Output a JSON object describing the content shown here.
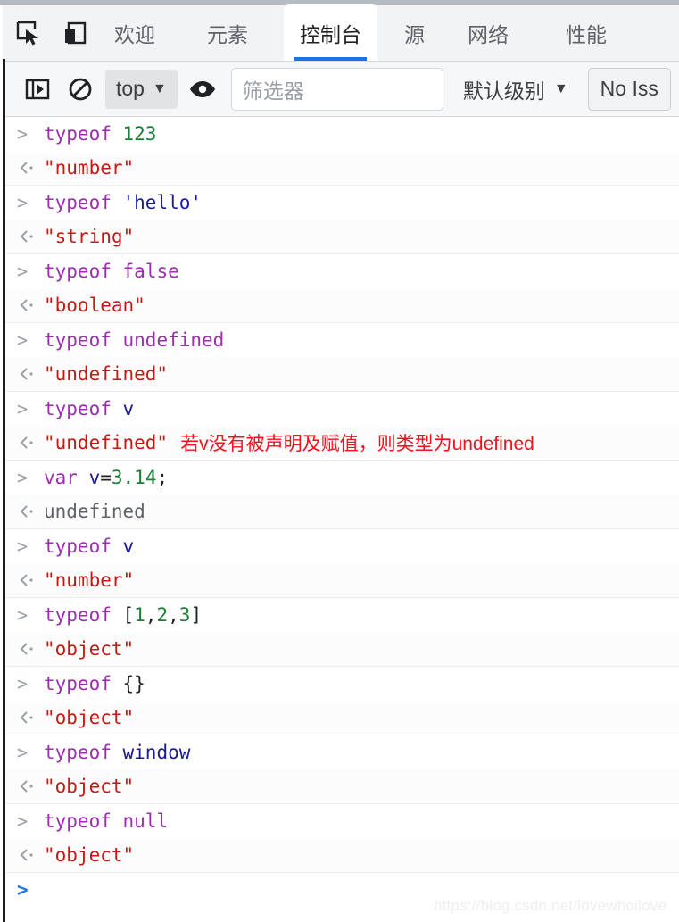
{
  "window": {
    "devtools_tabs": [
      {
        "label": "欢迎",
        "name": "tab-welcome",
        "active": false
      },
      {
        "label": "元素",
        "name": "tab-elements",
        "active": false
      },
      {
        "label": "控制台",
        "name": "tab-console",
        "active": true
      },
      {
        "label": "源",
        "name": "tab-sources",
        "active": false
      },
      {
        "label": "网络",
        "name": "tab-network",
        "active": false
      },
      {
        "label": "性能",
        "name": "tab-performance",
        "active": false
      }
    ],
    "icons": {
      "inspect": "inspect-element-icon",
      "device": "device-toolbar-icon"
    },
    "accent_color": "#1a73e8"
  },
  "toolbar": {
    "sidebar_toggle_icon": "console-sidebar-icon",
    "clear_console_icon": "clear-console-icon",
    "context_selector": {
      "value": "top",
      "caret": "▼"
    },
    "eye_icon": "live-expression-eye-icon",
    "filter": {
      "placeholder": "筛选器",
      "value": ""
    },
    "level_selector": {
      "label": "默认级别",
      "caret": "▼"
    },
    "issues_button": {
      "label": "No Iss"
    }
  },
  "console": {
    "prompt_glyph": ">",
    "result_glyph": "‹·",
    "input_prompt": ">",
    "entries": [
      {
        "command_parts": [
          {
            "text": "typeof ",
            "cls": "kw"
          },
          {
            "text": "123",
            "cls": "num"
          }
        ],
        "result": "\"number\"",
        "result_cls": "res-str",
        "note": ""
      },
      {
        "command_parts": [
          {
            "text": "typeof ",
            "cls": "kw"
          },
          {
            "text": "'hello'",
            "cls": "str"
          }
        ],
        "result": "\"string\"",
        "result_cls": "res-str",
        "note": ""
      },
      {
        "command_parts": [
          {
            "text": "typeof ",
            "cls": "kw"
          },
          {
            "text": "false",
            "cls": "kw"
          }
        ],
        "result": "\"boolean\"",
        "result_cls": "res-str",
        "note": ""
      },
      {
        "command_parts": [
          {
            "text": "typeof ",
            "cls": "kw"
          },
          {
            "text": "undefined",
            "cls": "kw"
          }
        ],
        "result": "\"undefined\"",
        "result_cls": "res-str",
        "note": ""
      },
      {
        "command_parts": [
          {
            "text": "typeof ",
            "cls": "kw"
          },
          {
            "text": "v",
            "cls": "ident"
          }
        ],
        "result": "\"undefined\"",
        "result_cls": "res-str",
        "note": "若v没有被声明及赋值，则类型为undefined"
      },
      {
        "command_parts": [
          {
            "text": "var ",
            "cls": "kw"
          },
          {
            "text": "v",
            "cls": "ident"
          },
          {
            "text": "=",
            "cls": "punct"
          },
          {
            "text": "3.14",
            "cls": "num"
          },
          {
            "text": ";",
            "cls": "punct"
          }
        ],
        "result": "undefined",
        "result_cls": "res-und",
        "note": ""
      },
      {
        "command_parts": [
          {
            "text": "typeof ",
            "cls": "kw"
          },
          {
            "text": "v",
            "cls": "ident"
          }
        ],
        "result": "\"number\"",
        "result_cls": "res-str",
        "note": ""
      },
      {
        "command_parts": [
          {
            "text": "typeof ",
            "cls": "kw"
          },
          {
            "text": "[",
            "cls": "punct"
          },
          {
            "text": "1",
            "cls": "num"
          },
          {
            "text": ",",
            "cls": "punct"
          },
          {
            "text": "2",
            "cls": "num"
          },
          {
            "text": ",",
            "cls": "punct"
          },
          {
            "text": "3",
            "cls": "num"
          },
          {
            "text": "]",
            "cls": "punct"
          }
        ],
        "result": "\"object\"",
        "result_cls": "res-str",
        "note": ""
      },
      {
        "command_parts": [
          {
            "text": "typeof ",
            "cls": "kw"
          },
          {
            "text": "{}",
            "cls": "punct"
          }
        ],
        "result": "\"object\"",
        "result_cls": "res-str",
        "note": ""
      },
      {
        "command_parts": [
          {
            "text": "typeof ",
            "cls": "kw"
          },
          {
            "text": "window",
            "cls": "ident"
          }
        ],
        "result": "\"object\"",
        "result_cls": "res-str",
        "note": ""
      },
      {
        "command_parts": [
          {
            "text": "typeof ",
            "cls": "kw"
          },
          {
            "text": "null",
            "cls": "kw"
          }
        ],
        "result": "\"object\"",
        "result_cls": "res-str",
        "note": ""
      }
    ]
  },
  "watermark": {
    "text": "https://blog.csdn.net/lovewhoilove"
  }
}
